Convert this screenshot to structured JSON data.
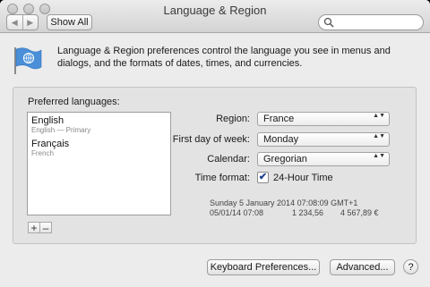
{
  "window": {
    "title": "Language & Region"
  },
  "toolbar": {
    "back_glyph": "◀",
    "forward_glyph": "▶",
    "show_all_label": "Show All",
    "search_value": ""
  },
  "intro_text": "Language & Region preferences control the language you see in menus and dialogs, and the formats of dates, times, and currencies.",
  "languages": {
    "label": "Preferred languages:",
    "items": [
      {
        "name": "English",
        "detail": "English — Primary"
      },
      {
        "name": "Français",
        "detail": "French"
      }
    ],
    "add_label": "+",
    "remove_label": "–"
  },
  "settings": {
    "region": {
      "label": "Region:",
      "value": "France"
    },
    "first_day": {
      "label": "First day of week:",
      "value": "Monday"
    },
    "calendar": {
      "label": "Calendar:",
      "value": "Gregorian"
    },
    "time_format": {
      "label": "Time format:",
      "checkbox_label": "24-Hour Time",
      "checked": true,
      "check_glyph": "✔"
    }
  },
  "sample": {
    "line1": "Sunday 5 January 2014 07:08:09 GMT+1",
    "short_date": "05/01/14 07:08",
    "number": "1 234,56",
    "currency": "4 567,89 €"
  },
  "buttons": {
    "keyboard": "Keyboard Preferences...",
    "advanced": "Advanced...",
    "help": "?"
  },
  "popup_arrows": "▲▼",
  "colors": {
    "window_bg": "#ececec",
    "panel_bg": "#e3e3e3",
    "flag_blue": "#4a8fd8"
  }
}
